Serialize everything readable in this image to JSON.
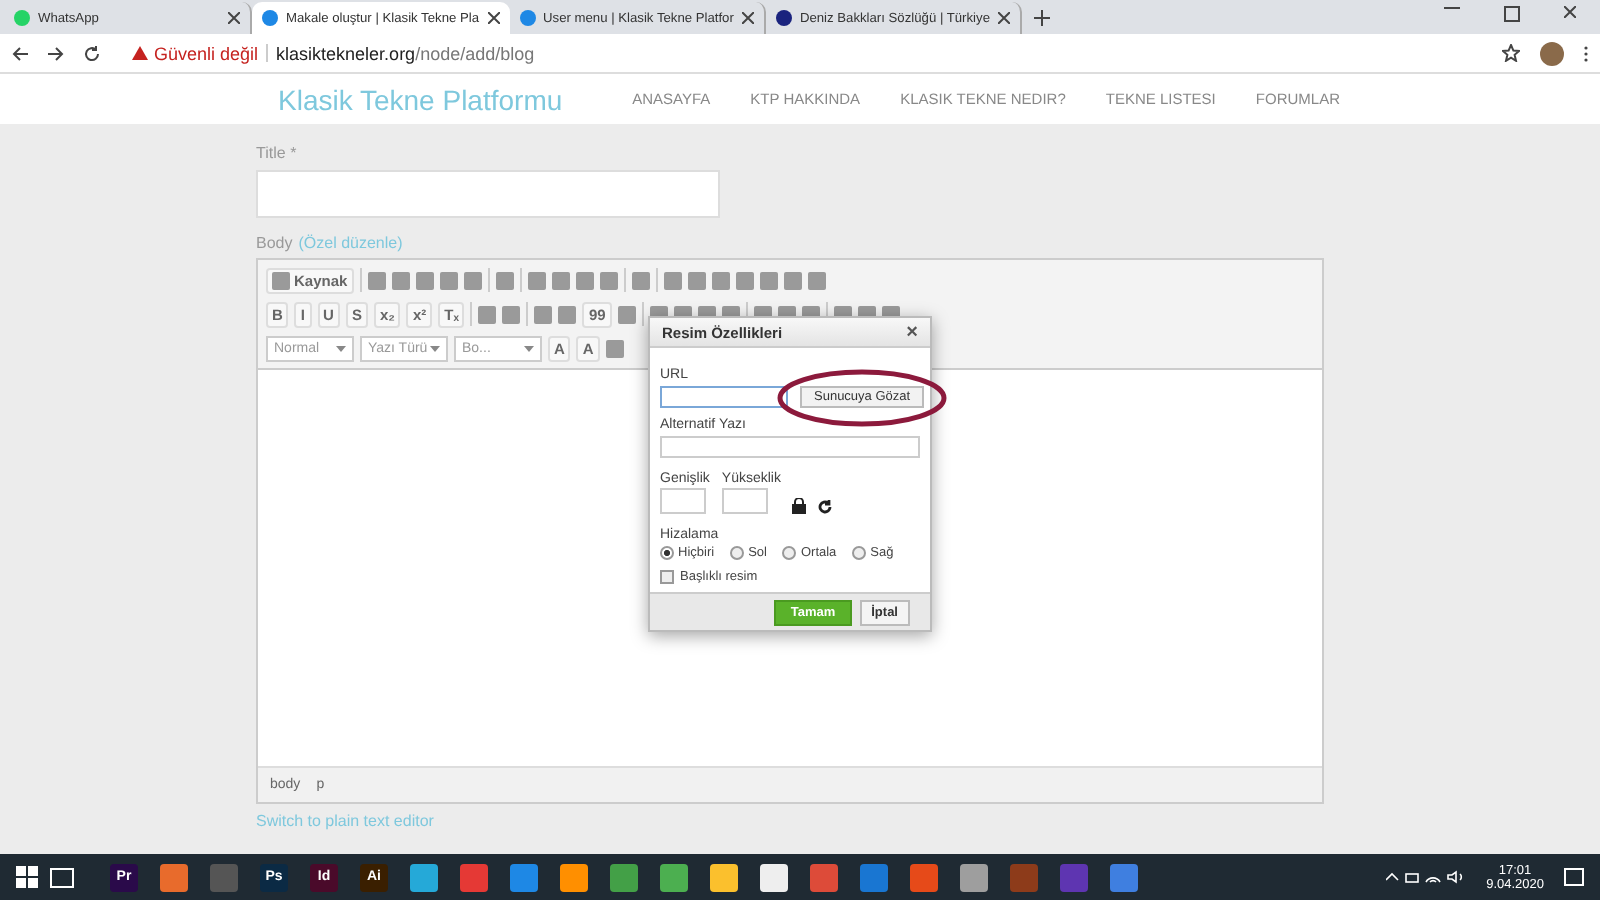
{
  "browser": {
    "tabs": [
      {
        "title": "WhatsApp",
        "selected": false,
        "color": "#25d366"
      },
      {
        "title": "Makale oluştur | Klasik Tekne Pla",
        "selected": true,
        "color": "#1e88e5"
      },
      {
        "title": "User menu | Klasik Tekne Platfor",
        "selected": false,
        "color": "#1e88e5"
      },
      {
        "title": "Deniz Bakkları Sözlüğü | Türkiye",
        "selected": false,
        "color": "#1a237e"
      }
    ],
    "security": "Güvenli değil",
    "url_host": "klasiktekneler.org",
    "url_path": "/node/add/blog"
  },
  "site": {
    "logo": "Klasik Tekne Platformu",
    "nav": [
      "ANASAYFA",
      "KTP HAKKINDA",
      "KLASIK TEKNE NEDIR?",
      "TEKNE LISTESI",
      "FORUMLAR"
    ]
  },
  "form": {
    "title_label": "Title",
    "required_mark": "*",
    "body_label": "Body",
    "body_format": "(Özel düzenle)",
    "toolbar_rows": [
      [
        {
          "kind": "text",
          "label": "Kaynak"
        },
        {
          "kind": "sep"
        },
        {
          "kind": "icon"
        },
        {
          "kind": "icon"
        },
        {
          "kind": "icon"
        },
        {
          "kind": "icon"
        },
        {
          "kind": "icon"
        },
        {
          "kind": "sep"
        },
        {
          "kind": "icon"
        },
        {
          "kind": "sep"
        },
        {
          "kind": "icon"
        },
        {
          "kind": "icon"
        },
        {
          "kind": "icon"
        },
        {
          "kind": "icon"
        },
        {
          "kind": "sep"
        },
        {
          "kind": "icon"
        },
        {
          "kind": "sep"
        },
        {
          "kind": "icon"
        },
        {
          "kind": "icon"
        },
        {
          "kind": "icon"
        },
        {
          "kind": "icon"
        },
        {
          "kind": "icon"
        },
        {
          "kind": "icon"
        },
        {
          "kind": "icon"
        }
      ],
      [
        {
          "kind": "glyph",
          "label": "B"
        },
        {
          "kind": "glyph",
          "label": "I"
        },
        {
          "kind": "glyph",
          "label": "U"
        },
        {
          "kind": "glyph",
          "label": "S"
        },
        {
          "kind": "glyph",
          "label": "x₂"
        },
        {
          "kind": "glyph",
          "label": "x²"
        },
        {
          "kind": "glyph",
          "label": "Tₓ"
        },
        {
          "kind": "sep"
        },
        {
          "kind": "icon"
        },
        {
          "kind": "icon"
        },
        {
          "kind": "sep"
        },
        {
          "kind": "icon"
        },
        {
          "kind": "icon"
        },
        {
          "kind": "glyph",
          "label": "99"
        },
        {
          "kind": "icon"
        },
        {
          "kind": "sep"
        },
        {
          "kind": "icon"
        },
        {
          "kind": "icon"
        },
        {
          "kind": "icon"
        },
        {
          "kind": "icon"
        },
        {
          "kind": "sep"
        },
        {
          "kind": "icon"
        },
        {
          "kind": "icon"
        },
        {
          "kind": "icon"
        },
        {
          "kind": "sep"
        },
        {
          "kind": "icon"
        },
        {
          "kind": "icon"
        },
        {
          "kind": "icon"
        }
      ],
      [
        {
          "kind": "combo",
          "label": "Normal"
        },
        {
          "kind": "combo",
          "label": "Yazı Türü"
        },
        {
          "kind": "combo",
          "label": "Bo..."
        },
        {
          "kind": "glyph",
          "label": "A"
        },
        {
          "kind": "glyph",
          "label": "A"
        },
        {
          "kind": "icon"
        }
      ]
    ],
    "path": [
      "body",
      "p"
    ],
    "switch_link": "Switch to plain text editor"
  },
  "dialog": {
    "title": "Resim Özellikleri",
    "close": "×",
    "url_label": "URL",
    "browse": "Sunucuya Gözat",
    "alt_label": "Alternatif Yazı",
    "width_label": "Genişlik",
    "height_label": "Yükseklik",
    "align_label": "Hizalama",
    "align_options": [
      {
        "label": "Hiçbiri",
        "selected": true
      },
      {
        "label": "Sol",
        "selected": false
      },
      {
        "label": "Ortala",
        "selected": false
      },
      {
        "label": "Sağ",
        "selected": false
      }
    ],
    "caption": {
      "label": "Başlıklı resim",
      "checked": false
    },
    "ok": "Tamam",
    "cancel": "İptal"
  },
  "taskbar": {
    "apps": [
      {
        "label": "Pr",
        "color": "#2a0a4a"
      },
      {
        "color": "#e86b2c"
      },
      {
        "color": "#555555"
      },
      {
        "label": "Ps",
        "color": "#0b2a44"
      },
      {
        "label": "Id",
        "color": "#4a0a2a"
      },
      {
        "label": "Ai",
        "color": "#3a1f00"
      },
      {
        "color": "#25a9d8"
      },
      {
        "color": "#e53935"
      },
      {
        "color": "#1e88e5"
      },
      {
        "color": "#ff8f00"
      },
      {
        "color": "#43a047"
      },
      {
        "color": "#4caf50"
      },
      {
        "color": "#fbc02d"
      },
      {
        "color": "#eeeeee"
      },
      {
        "color": "#dd4b39"
      },
      {
        "color": "#1976d2"
      },
      {
        "color": "#e64a19"
      },
      {
        "color": "#9e9e9e"
      },
      {
        "color": "#8d3b1a"
      },
      {
        "color": "#5e35b1"
      },
      {
        "color": "#3f7fe0"
      }
    ],
    "time": "17:01",
    "date": "9.04.2020"
  }
}
